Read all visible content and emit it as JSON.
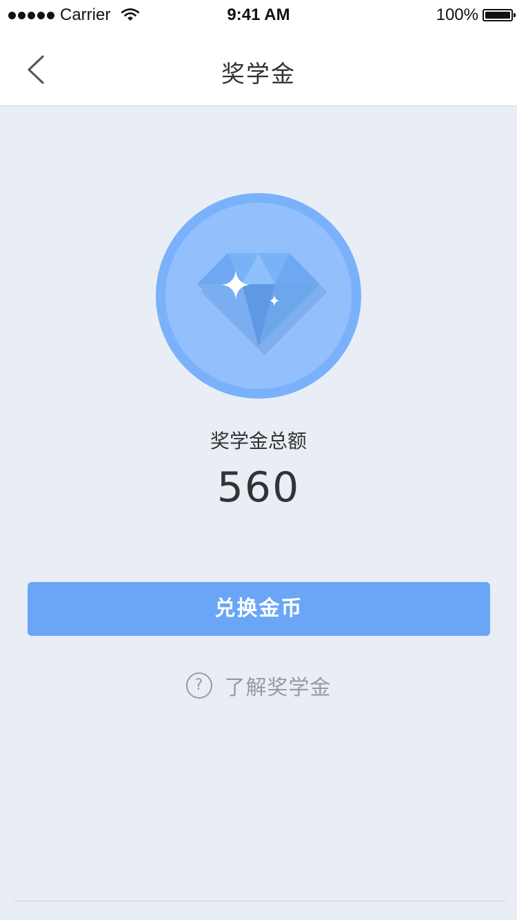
{
  "status_bar": {
    "carrier": "Carrier",
    "time": "9:41 AM",
    "battery": "100%"
  },
  "nav": {
    "title": "奖学金",
    "back_icon": "chevron-left-icon"
  },
  "badge": {
    "icon": "diamond-icon",
    "outer_color": "#7ab1fb",
    "inner_color": "#93c0fd"
  },
  "scholarship": {
    "total_label": "奖学金总额",
    "total_value": "560"
  },
  "actions": {
    "exchange_label": "兑换金币",
    "exchange_color": "#6ba5f6",
    "help_icon_glyph": "?",
    "learn_label": "了解奖学金"
  }
}
